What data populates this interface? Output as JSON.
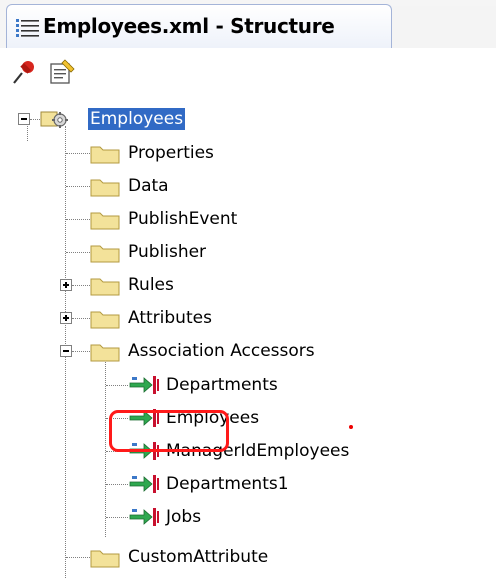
{
  "panel": {
    "title": "Employees.xml - Structure"
  },
  "toolbar": {
    "pin": "pin-icon",
    "edit": "edit-icon"
  },
  "tree": {
    "root": {
      "label": "Employees",
      "expanded": true,
      "selected": true
    },
    "children": [
      {
        "label": "Properties"
      },
      {
        "label": "Data"
      },
      {
        "label": "PublishEvent"
      },
      {
        "label": "Publisher"
      },
      {
        "label": "Rules",
        "expander": "+"
      },
      {
        "label": "Attributes",
        "expander": "+"
      },
      {
        "label": "Association Accessors",
        "expander": "-"
      },
      {
        "label": "CustomAttribute"
      }
    ],
    "accessors": [
      {
        "label": "Departments"
      },
      {
        "label": "Employees"
      },
      {
        "label": "ManagerIdEmployees"
      },
      {
        "label": "Departments1"
      },
      {
        "label": "Jobs",
        "highlighted": true
      }
    ]
  },
  "colors": {
    "selection": "#316ac5",
    "highlight": "#ff1a1a",
    "folder": "#f3e29a",
    "accessor_arrow": "#2fa84f",
    "accessor_bar": "#c8102e"
  }
}
